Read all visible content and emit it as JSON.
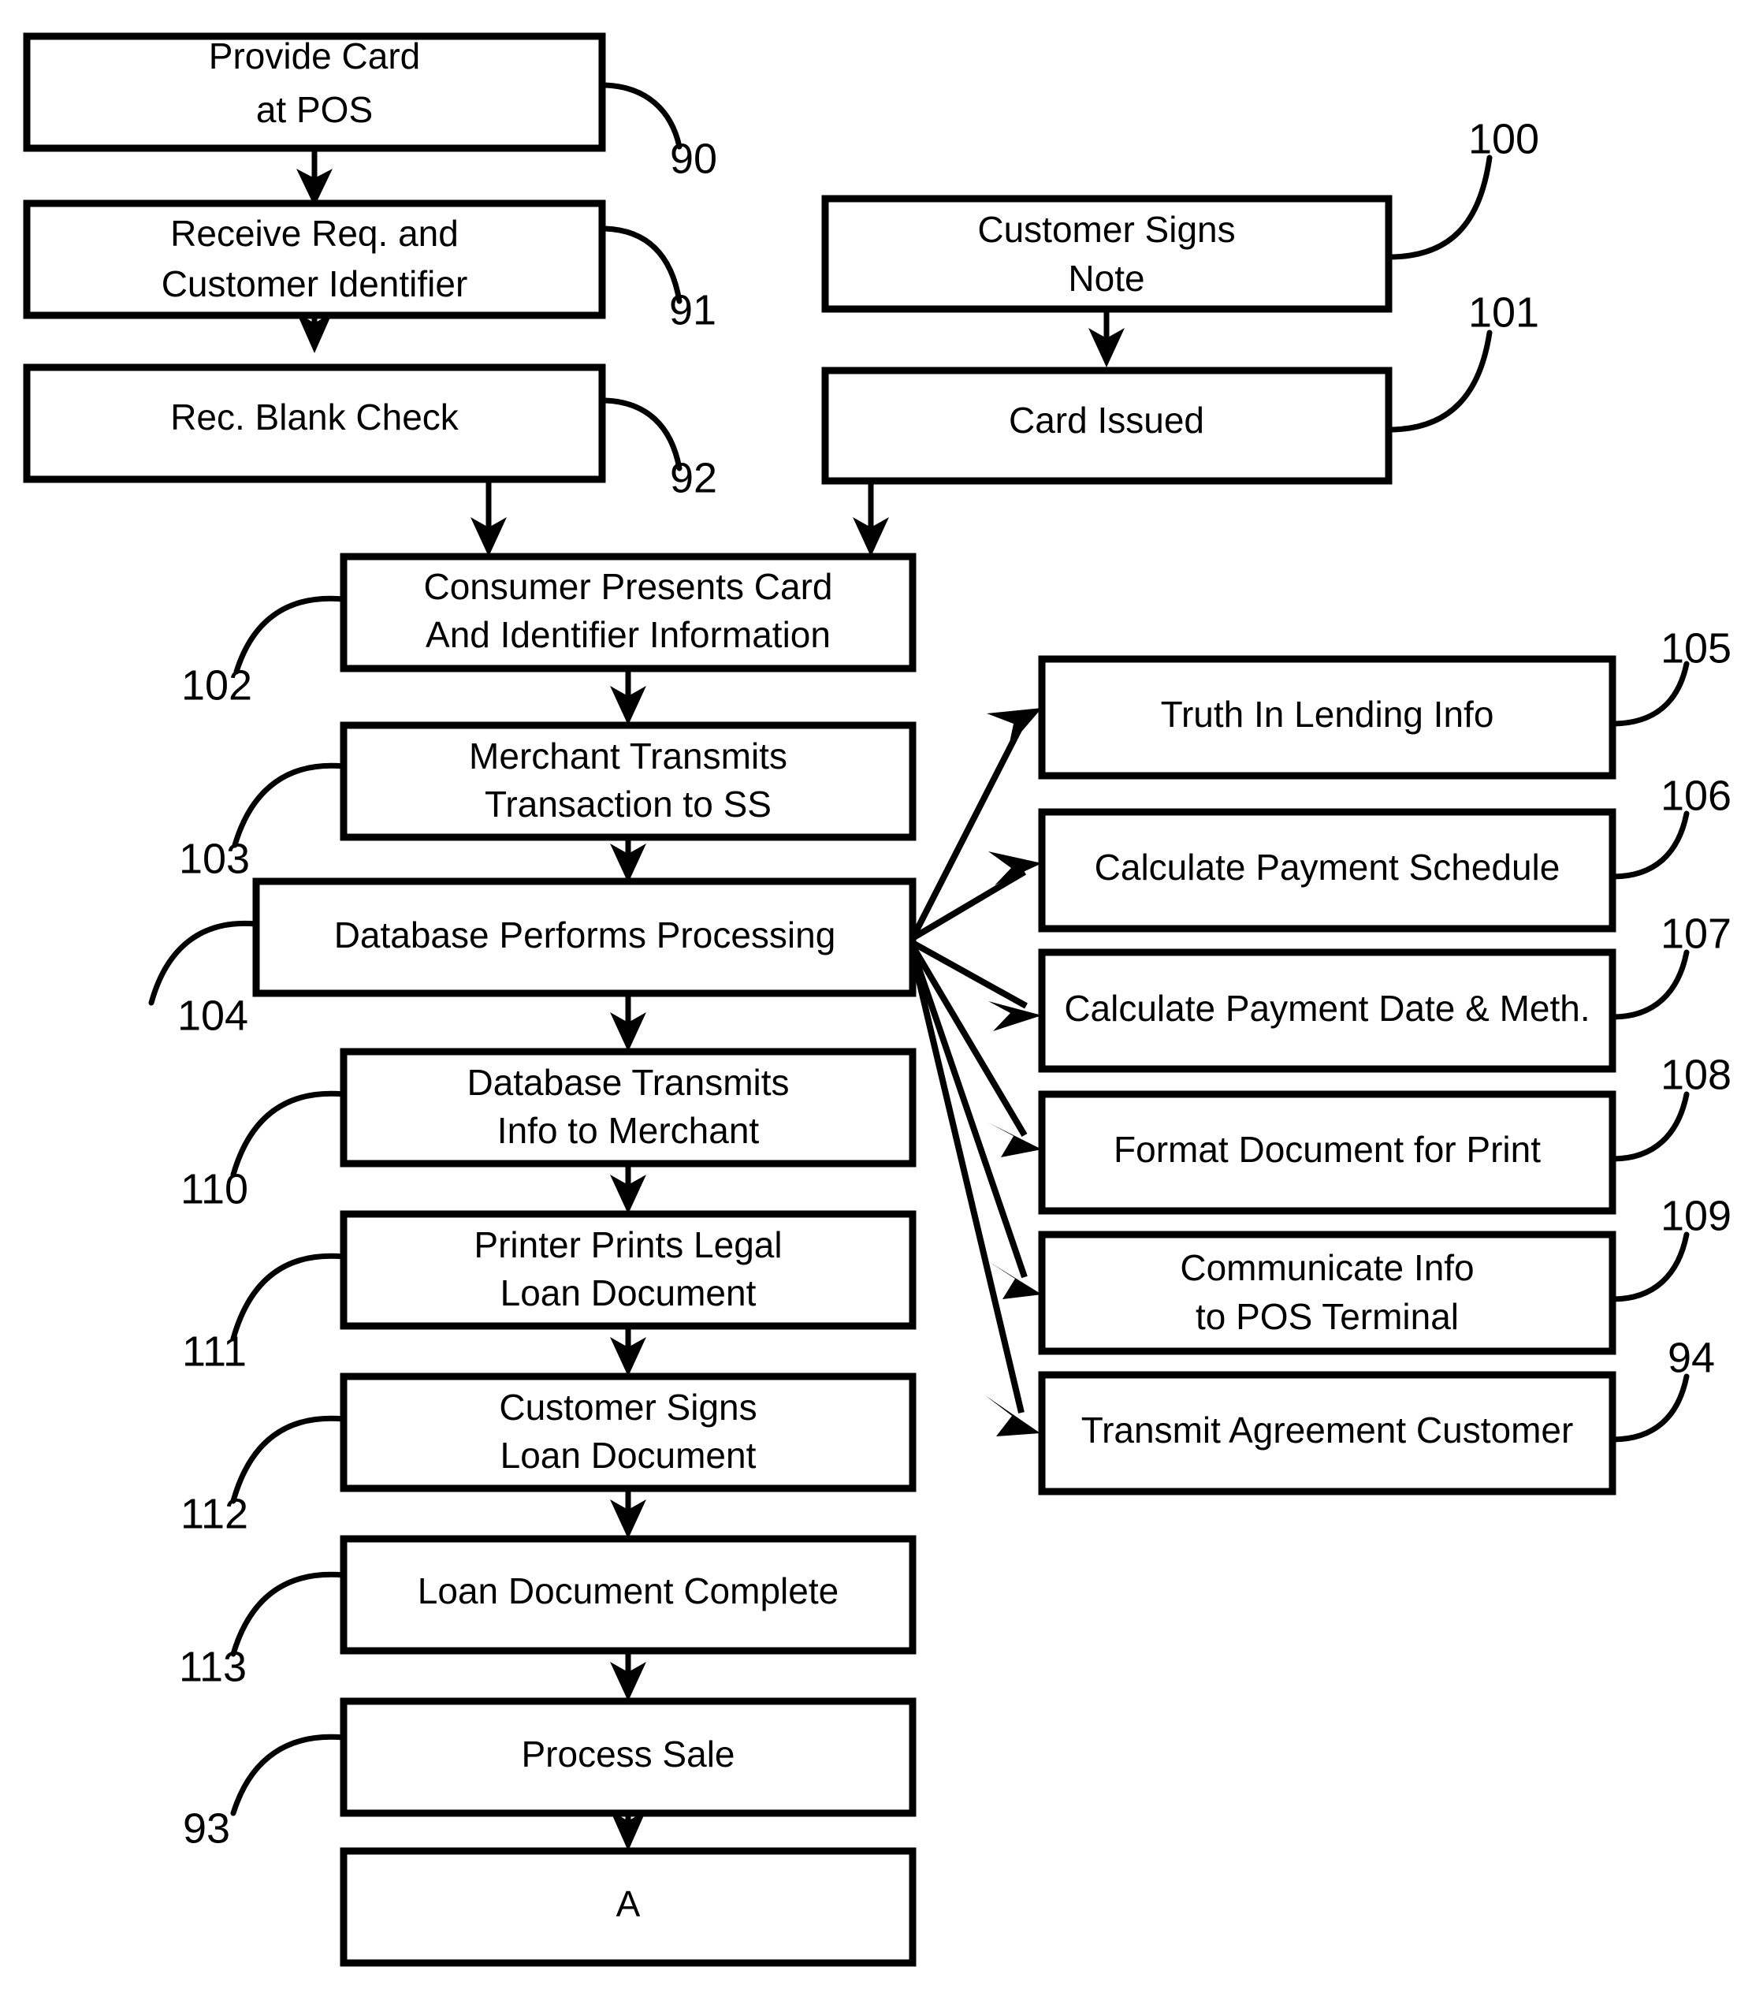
{
  "diagram": {
    "title": "Card Issuance and Point-of-Sale Loan Document Flowchart",
    "line_color": "#000000",
    "box_fill": "#ffffff",
    "nodes": [
      {
        "id": "n90",
        "ref": "90",
        "lines": [
          "Provide Card",
          "at POS"
        ]
      },
      {
        "id": "n91",
        "ref": "91",
        "lines": [
          "Receive Req. and",
          "Customer Identifier"
        ]
      },
      {
        "id": "n92",
        "ref": "92",
        "lines": [
          "Rec. Blank Check"
        ]
      },
      {
        "id": "n100",
        "ref": "100",
        "lines": [
          "Customer Signs",
          "Note"
        ]
      },
      {
        "id": "n101",
        "ref": "101",
        "lines": [
          "Card Issued"
        ]
      },
      {
        "id": "n102",
        "ref": "102",
        "lines": [
          "Consumer Presents Card",
          "And Identifier Information"
        ]
      },
      {
        "id": "n103",
        "ref": "103",
        "lines": [
          "Merchant Transmits",
          "Transaction to SS"
        ]
      },
      {
        "id": "n104",
        "ref": "104",
        "lines": [
          "Database Performs Processing"
        ]
      },
      {
        "id": "n110",
        "ref": "110",
        "lines": [
          "Database Transmits",
          "Info to Merchant"
        ]
      },
      {
        "id": "n111",
        "ref": "111",
        "lines": [
          "Printer Prints Legal",
          "Loan Document"
        ]
      },
      {
        "id": "n112",
        "ref": "112",
        "lines": [
          "Customer Signs",
          "Loan Document"
        ]
      },
      {
        "id": "n113",
        "ref": "113",
        "lines": [
          "Loan Document Complete"
        ]
      },
      {
        "id": "n93",
        "ref": "93",
        "lines": [
          "Process Sale"
        ]
      },
      {
        "id": "nA",
        "ref": "",
        "lines": [
          "A"
        ]
      },
      {
        "id": "n105",
        "ref": "105",
        "lines": [
          "Truth In Lending Info"
        ]
      },
      {
        "id": "n106",
        "ref": "106",
        "lines": [
          "Calculate Payment Schedule"
        ]
      },
      {
        "id": "n107",
        "ref": "107",
        "lines": [
          "Calculate Payment Date & Meth."
        ]
      },
      {
        "id": "n108",
        "ref": "108",
        "lines": [
          "Format Document for Print"
        ]
      },
      {
        "id": "n109",
        "ref": "109",
        "lines": [
          "Communicate Info",
          "to POS Terminal"
        ]
      },
      {
        "id": "n94",
        "ref": "94",
        "lines": [
          "Transmit Agreement Customer"
        ]
      }
    ],
    "edges": [
      {
        "from": "n90",
        "to": "n91",
        "kind": "vertical"
      },
      {
        "from": "n91",
        "to": "n92",
        "kind": "vertical"
      },
      {
        "from": "n92",
        "to": "n102",
        "kind": "vertical"
      },
      {
        "from": "n100",
        "to": "n101",
        "kind": "vertical"
      },
      {
        "from": "n101",
        "to": "n102",
        "kind": "vertical"
      },
      {
        "from": "n102",
        "to": "n103",
        "kind": "vertical"
      },
      {
        "from": "n103",
        "to": "n104",
        "kind": "vertical"
      },
      {
        "from": "n104",
        "to": "n110",
        "kind": "vertical"
      },
      {
        "from": "n110",
        "to": "n111",
        "kind": "vertical"
      },
      {
        "from": "n111",
        "to": "n112",
        "kind": "vertical"
      },
      {
        "from": "n112",
        "to": "n113",
        "kind": "vertical"
      },
      {
        "from": "n113",
        "to": "n93",
        "kind": "vertical"
      },
      {
        "from": "n93",
        "to": "nA",
        "kind": "vertical"
      },
      {
        "from": "n104",
        "to": "n105",
        "kind": "fan"
      },
      {
        "from": "n104",
        "to": "n106",
        "kind": "fan"
      },
      {
        "from": "n104",
        "to": "n107",
        "kind": "fan"
      },
      {
        "from": "n104",
        "to": "n108",
        "kind": "fan"
      },
      {
        "from": "n104",
        "to": "n109",
        "kind": "fan"
      },
      {
        "from": "n104",
        "to": "n94",
        "kind": "fan"
      }
    ]
  },
  "labels": {
    "n90_l0": "Provide Card",
    "n90_l1": "at POS",
    "n91_l0": "Receive Req. and",
    "n91_l1": "Customer Identifier",
    "n92_l0": "Rec. Blank Check",
    "n100_l0": "Customer Signs",
    "n100_l1": "Note",
    "n101_l0": "Card Issued",
    "n102_l0": "Consumer Presents Card",
    "n102_l1": "And Identifier Information",
    "n103_l0": "Merchant Transmits",
    "n103_l1": "Transaction to SS",
    "n104_l0": "Database Performs Processing",
    "n110_l0": "Database Transmits",
    "n110_l1": "Info to Merchant",
    "n111_l0": "Printer Prints Legal",
    "n111_l1": "Loan Document",
    "n112_l0": "Customer Signs",
    "n112_l1": "Loan Document",
    "n113_l0": "Loan Document Complete",
    "n93_l0": "Process Sale",
    "nA_l0": "A",
    "n105_l0": "Truth In Lending Info",
    "n106_l0": "Calculate Payment Schedule",
    "n107_l0": "Calculate Payment Date & Meth.",
    "n108_l0": "Format Document for Print",
    "n109_l0": "Communicate Info",
    "n109_l1": "to POS Terminal",
    "n94_l0": "Transmit Agreement Customer"
  },
  "refs": {
    "r90": "90",
    "r91": "91",
    "r92": "92",
    "r100": "100",
    "r101": "101",
    "r102": "102",
    "r103": "103",
    "r104": "104",
    "r110": "110",
    "r111": "111",
    "r112": "112",
    "r113": "113",
    "r93": "93",
    "r105": "105",
    "r106": "106",
    "r107": "107",
    "r108": "108",
    "r109": "109",
    "r94": "94"
  }
}
